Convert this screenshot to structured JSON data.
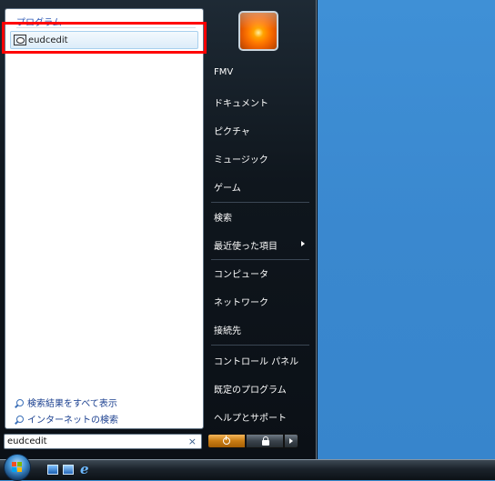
{
  "start_menu": {
    "programs_header": "プログラム",
    "search_result": "eudcedit",
    "see_all_results": "検索結果をすべて表示",
    "search_internet": "インターネットの検索",
    "search_value": "eudcedit",
    "clear_symbol": "×"
  },
  "right_pane": {
    "items": [
      "FMV",
      "ドキュメント",
      "ピクチャ",
      "ミュージック",
      "ゲーム",
      "検索",
      "最近使った項目",
      "コンピュータ",
      "ネットワーク",
      "接続先",
      "コントロール パネル",
      "既定のプログラム",
      "ヘルプとサポート"
    ]
  },
  "icons": {
    "program_icon": "eudcedit-app-icon",
    "search_icon": "magnifier-icon",
    "power": "power-icon",
    "lock": "lock-icon",
    "more": "arrow-right-icon",
    "start": "windows-orb-icon"
  },
  "colors": {
    "highlight_border": "#ff0000",
    "desktop": "#3a88cf",
    "link": "#1a3f8f",
    "power_button": "#c97c13"
  }
}
